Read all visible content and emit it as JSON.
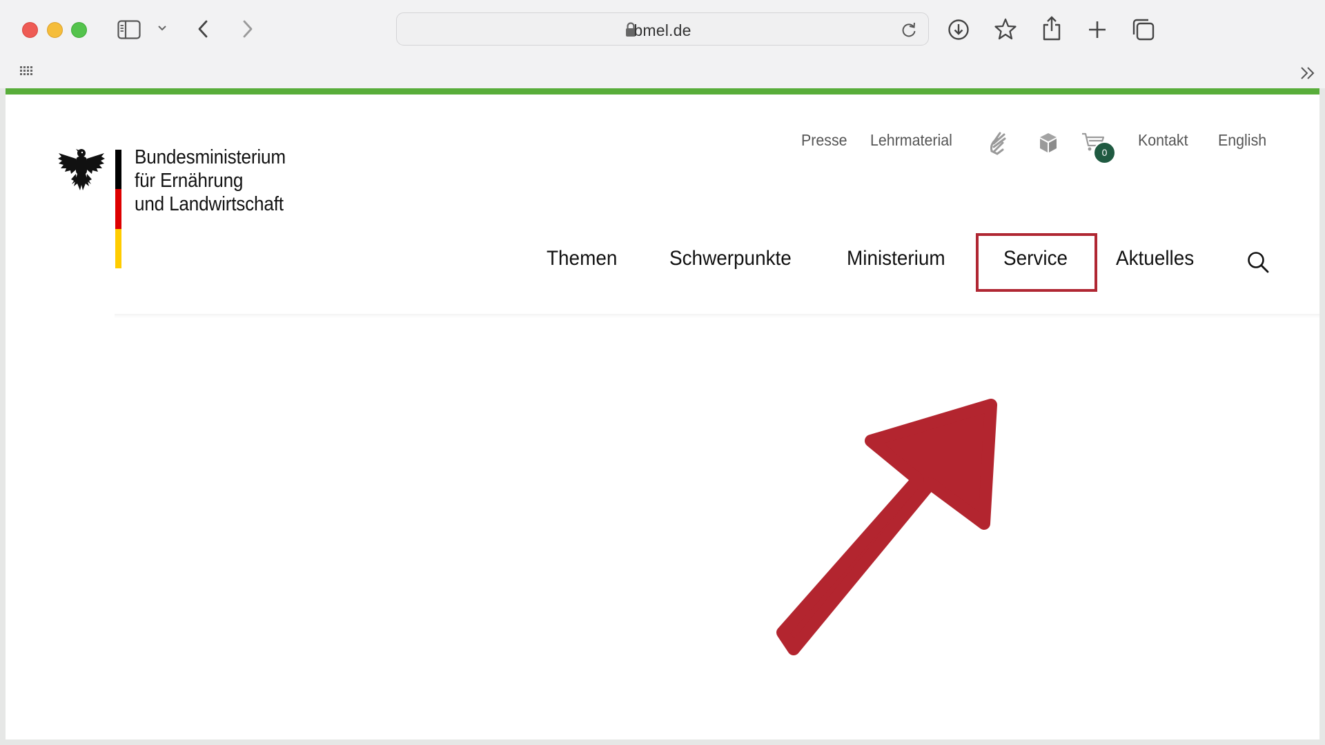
{
  "browser": {
    "url": "bmel.de",
    "icons": [
      "sidebar-icon",
      "chevron-down-icon",
      "back-icon",
      "forward-icon",
      "lock-icon",
      "reload-icon",
      "download-icon",
      "bookmark-star-icon",
      "share-icon",
      "new-tab-icon",
      "tab-overview-icon",
      "apps-grid-icon",
      "overflow-chevrons-icon"
    ]
  },
  "site": {
    "brand": {
      "line1": "Bundesministerium",
      "line2": "für Ernährung",
      "line3": "und Landwirtschaft"
    },
    "meta_nav": {
      "presse": "Presse",
      "lehrmaterial": "Lehrmaterial",
      "sign_language_icon": "sign-language-icon",
      "easy_language_icon": "easy-language-icon",
      "cart_count": "0",
      "kontakt": "Kontakt",
      "english": "English"
    },
    "main_nav": {
      "themen": "Themen",
      "schwerpunkte": "Schwerpunkte",
      "ministerium": "Ministerium",
      "service": "Service",
      "aktuelles": "Aktuelles"
    }
  },
  "colors": {
    "accent_green": "#58ad3a",
    "annotation_red": "#b02733",
    "badge_green": "#1f5a41",
    "flag_black": "#000000",
    "flag_red": "#dd0000",
    "flag_gold": "#ffcc00"
  }
}
